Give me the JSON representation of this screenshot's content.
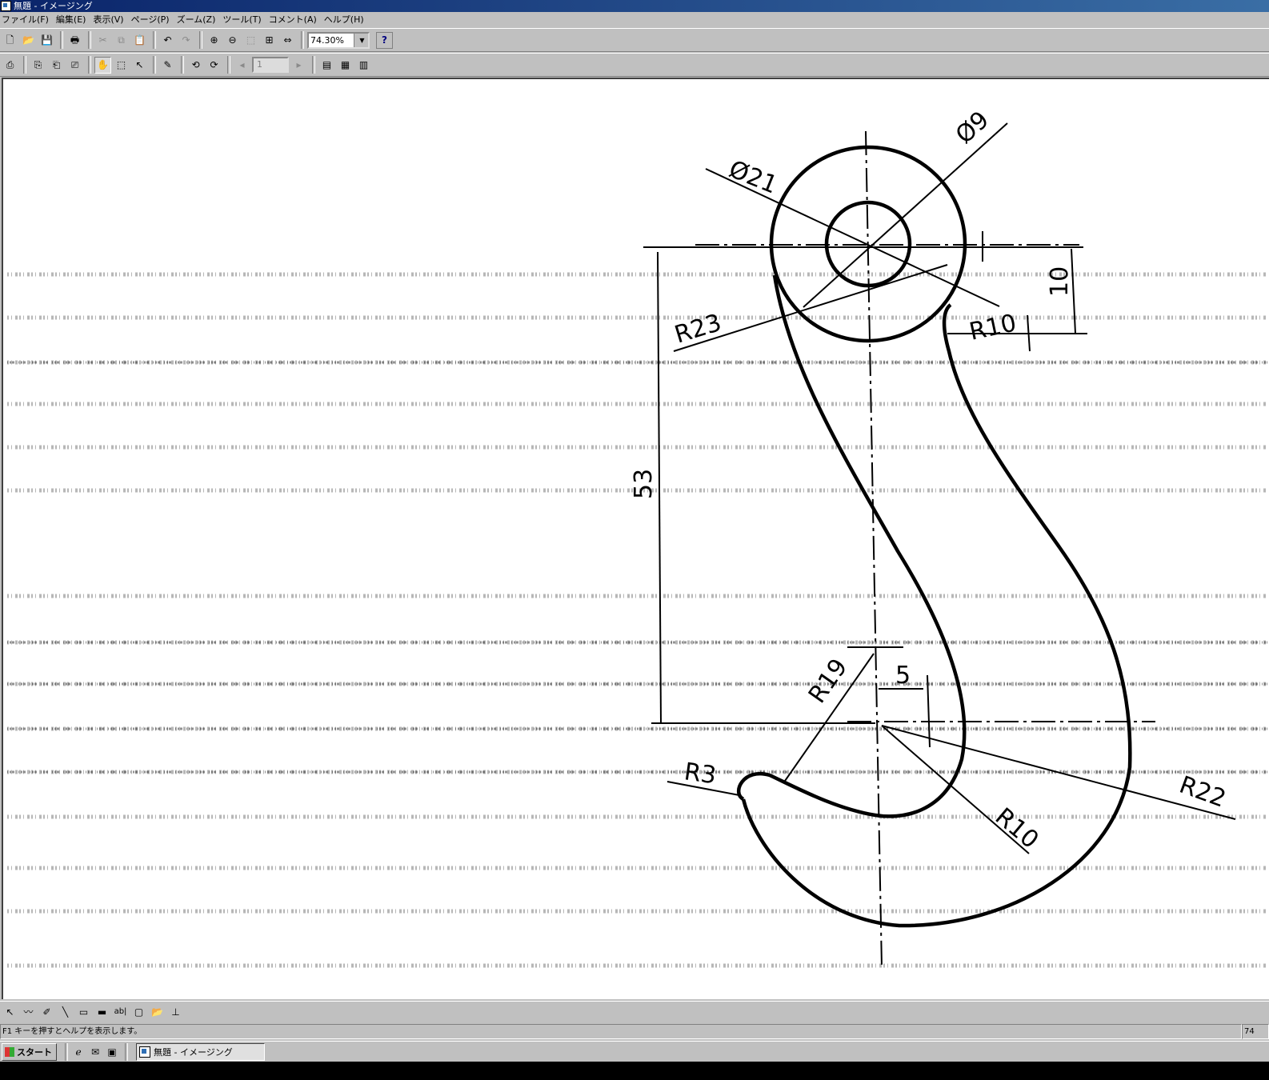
{
  "window": {
    "title": "無題 - イメージング"
  },
  "menu": [
    "ファイル(F)",
    "編集(E)",
    "表示(V)",
    "ページ(P)",
    "ズーム(Z)",
    "ツール(T)",
    "コメント(A)",
    "ヘルプ(H)"
  ],
  "toolbar": {
    "zoom_value": "74.30%",
    "help_glyph": "?"
  },
  "toolbar2": {
    "page_number": "1"
  },
  "drawing": {
    "labels": {
      "d21": "Ø21",
      "d9": "Ø9",
      "r23": "R23",
      "r10_top": "R10",
      "dim10": "10",
      "dim53": "53",
      "r19": "R19",
      "dim5": "5",
      "r3": "R3",
      "r10_bottom": "R10",
      "r22": "R22"
    }
  },
  "drawtools": {
    "text_tool_label": "ab|"
  },
  "status": {
    "message": "F1 キーを押すとヘルプを表示します。",
    "zoom_partial": "74"
  },
  "taskbar": {
    "start_label": "スタート",
    "task_item": "無題 - イメージング"
  },
  "colors": {
    "title_start": "#0a246a",
    "title_end": "#3a6ea5",
    "face": "#c0c0c0"
  }
}
